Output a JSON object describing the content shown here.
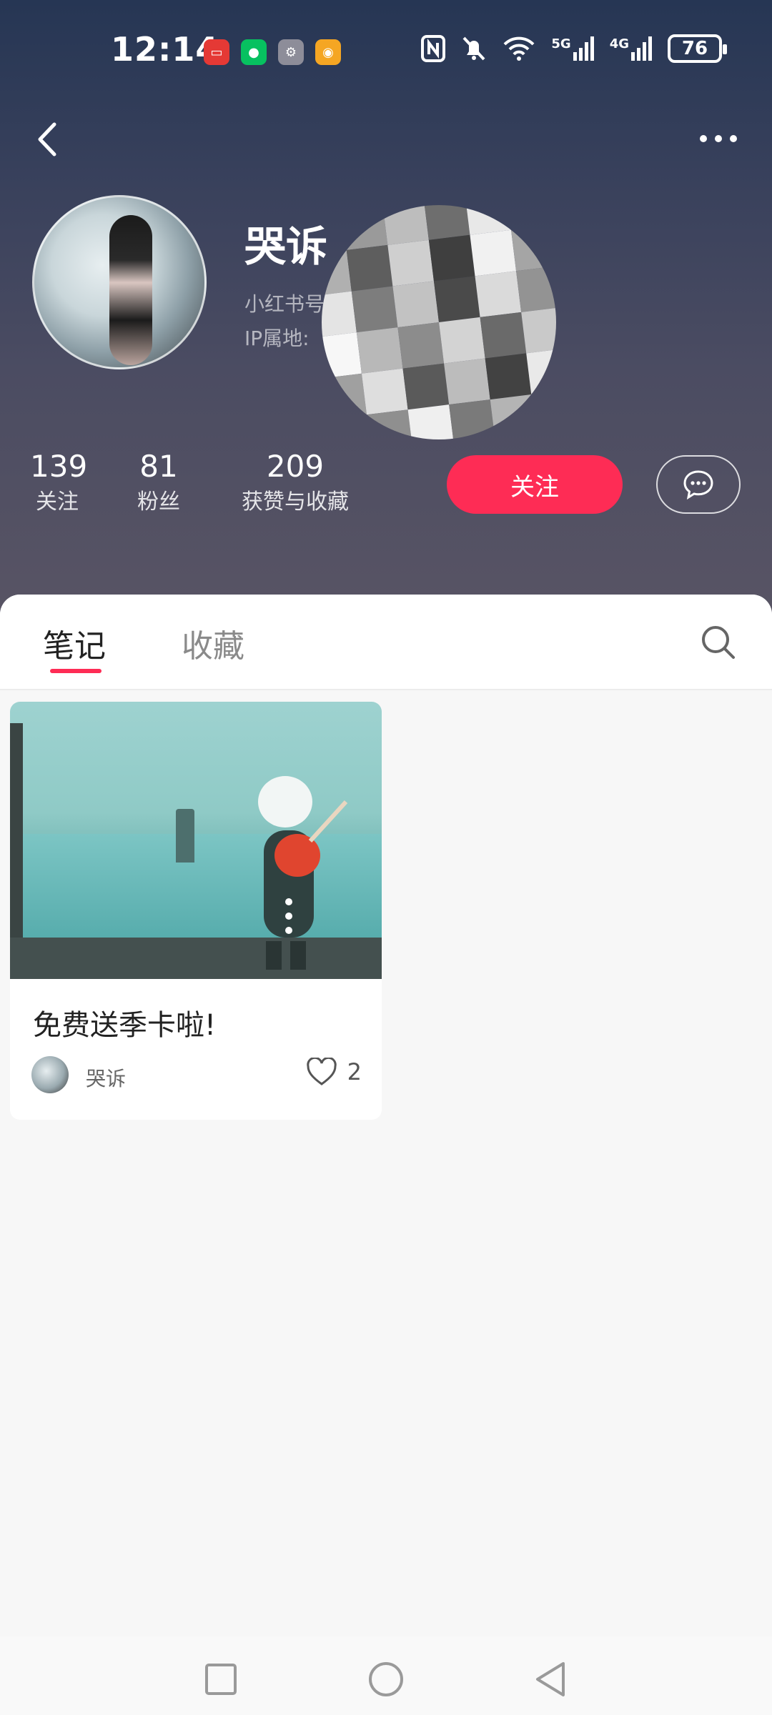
{
  "status_bar": {
    "time": "12:14",
    "battery": "76",
    "notification_icons": [
      "huawei-store-icon",
      "wechat-icon",
      "settings-icon",
      "weibo-icon"
    ],
    "system_icons": [
      "nfc-icon",
      "mute-icon",
      "wifi-icon",
      "5g-signal-icon",
      "4g-signal-icon"
    ],
    "network_5g": "5G",
    "network_4g": "4G"
  },
  "profile": {
    "name": "哭诉",
    "id_label": "小红书号",
    "ip_label": "IP属地:",
    "stats": [
      {
        "value": "139",
        "label": "关注"
      },
      {
        "value": "81",
        "label": "粉丝"
      },
      {
        "value": "209",
        "label": "获赞与收藏"
      }
    ],
    "follow_label": "关注"
  },
  "tabs": [
    {
      "label": "笔记",
      "active": true
    },
    {
      "label": "收藏",
      "active": false
    }
  ],
  "notes": [
    {
      "title": "免费送季卡啦!",
      "author": "哭诉",
      "likes": "2"
    }
  ],
  "colors": {
    "accent": "#fe2c55",
    "header_top": "#263654",
    "header_bottom": "#585464"
  }
}
